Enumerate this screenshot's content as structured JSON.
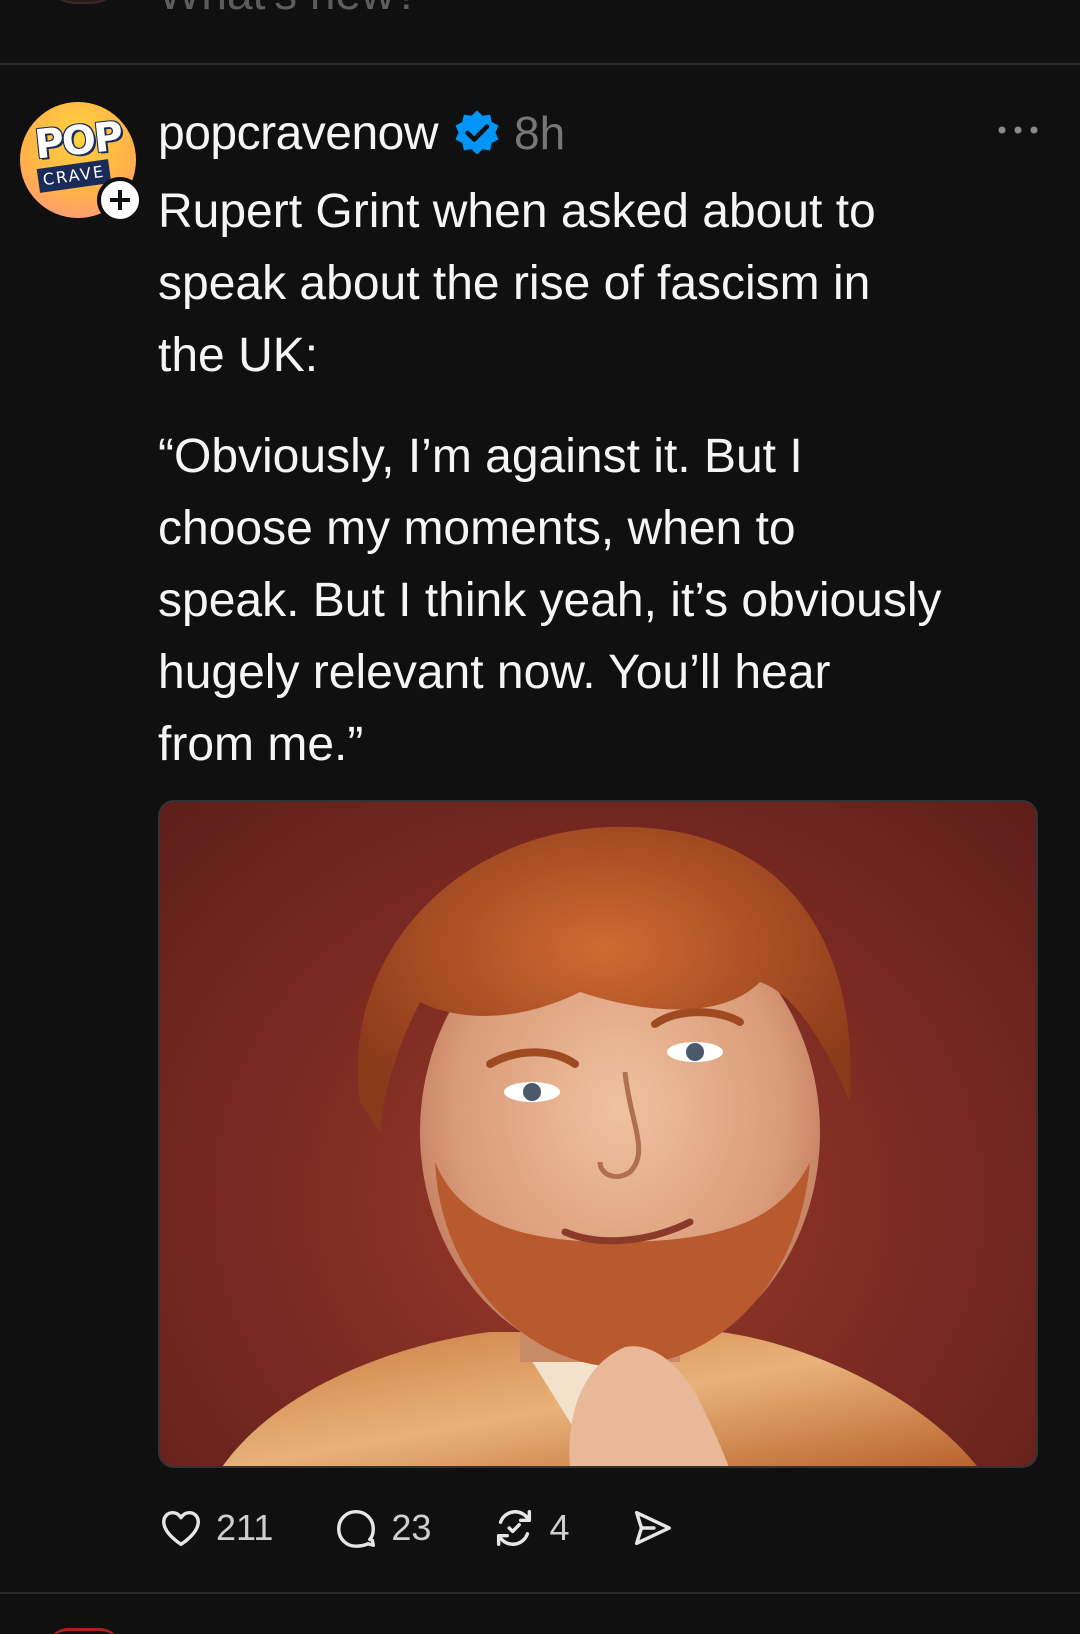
{
  "composer": {
    "placeholder": "What's new?"
  },
  "post": {
    "username": "popcravenow",
    "verified": true,
    "timestamp": "8h",
    "avatar": {
      "logo_top": "POP",
      "logo_bottom": "CRAVE"
    },
    "text_intro": "Rupert Grint when asked about to\nspeak about the rise of fascism in\nthe UK:",
    "text_quote": "“Obviously, I’m against it. But I\nchoose my moments, when to\nspeak. But I think yeah, it’s obviously\nhugely relevant now. You’ll hear\nfrom me.”",
    "actions": {
      "likes": "211",
      "replies": "23",
      "reposts": "4"
    }
  },
  "colors": {
    "background": "#101010",
    "text": "#f3f5f7",
    "muted": "#777777",
    "verified_blue": "#0095f6"
  }
}
